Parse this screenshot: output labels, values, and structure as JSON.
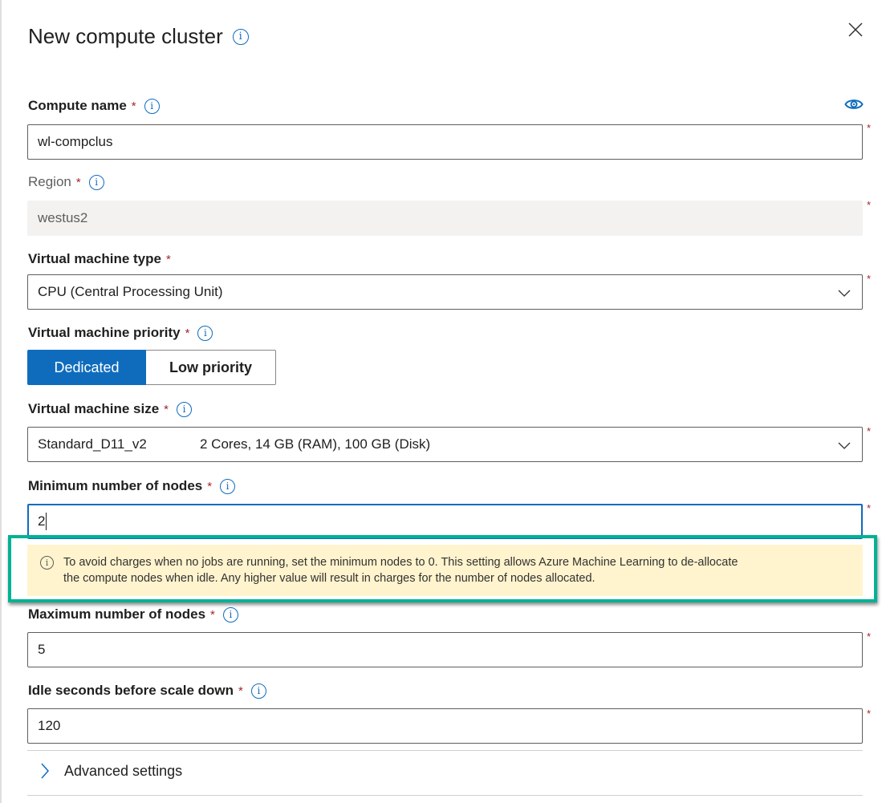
{
  "panel": {
    "title": "New compute cluster",
    "close_label": "Close",
    "eye_label": "Show"
  },
  "fields": {
    "compute_name": {
      "label": "Compute name",
      "required": "*",
      "value": "wl-compclus"
    },
    "region": {
      "label": "Region",
      "required": "*",
      "value": "westus2"
    },
    "vm_type": {
      "label": "Virtual machine type",
      "required": "*",
      "value": "CPU (Central Processing Unit)"
    },
    "vm_priority": {
      "label": "Virtual machine priority",
      "required": "*",
      "options": [
        {
          "label": "Dedicated",
          "selected": true
        },
        {
          "label": "Low priority",
          "selected": false
        }
      ]
    },
    "vm_size": {
      "label": "Virtual machine size",
      "required": "*",
      "name": "Standard_D11_v2",
      "spec": "2 Cores, 14 GB (RAM), 100 GB (Disk)"
    },
    "min_nodes": {
      "label": "Minimum number of nodes",
      "required": "*",
      "value": "2"
    },
    "max_nodes": {
      "label": "Maximum number of nodes",
      "required": "*",
      "value": "5"
    },
    "idle_seconds": {
      "label": "Idle seconds before scale down",
      "required": "*",
      "value": "120"
    }
  },
  "warning": {
    "line1": "To avoid charges when no jobs are running, set the minimum nodes to 0. This setting allows Azure Machine Learning to de-allocate",
    "line2": "the compute nodes when idle. Any higher value will result in charges for the number of nodes allocated."
  },
  "advanced": {
    "label": "Advanced settings"
  },
  "colors": {
    "accent": "#0f6cbd",
    "required": "#a4262c",
    "warning_bg": "#fff4ce",
    "highlight_border": "#00b294"
  }
}
